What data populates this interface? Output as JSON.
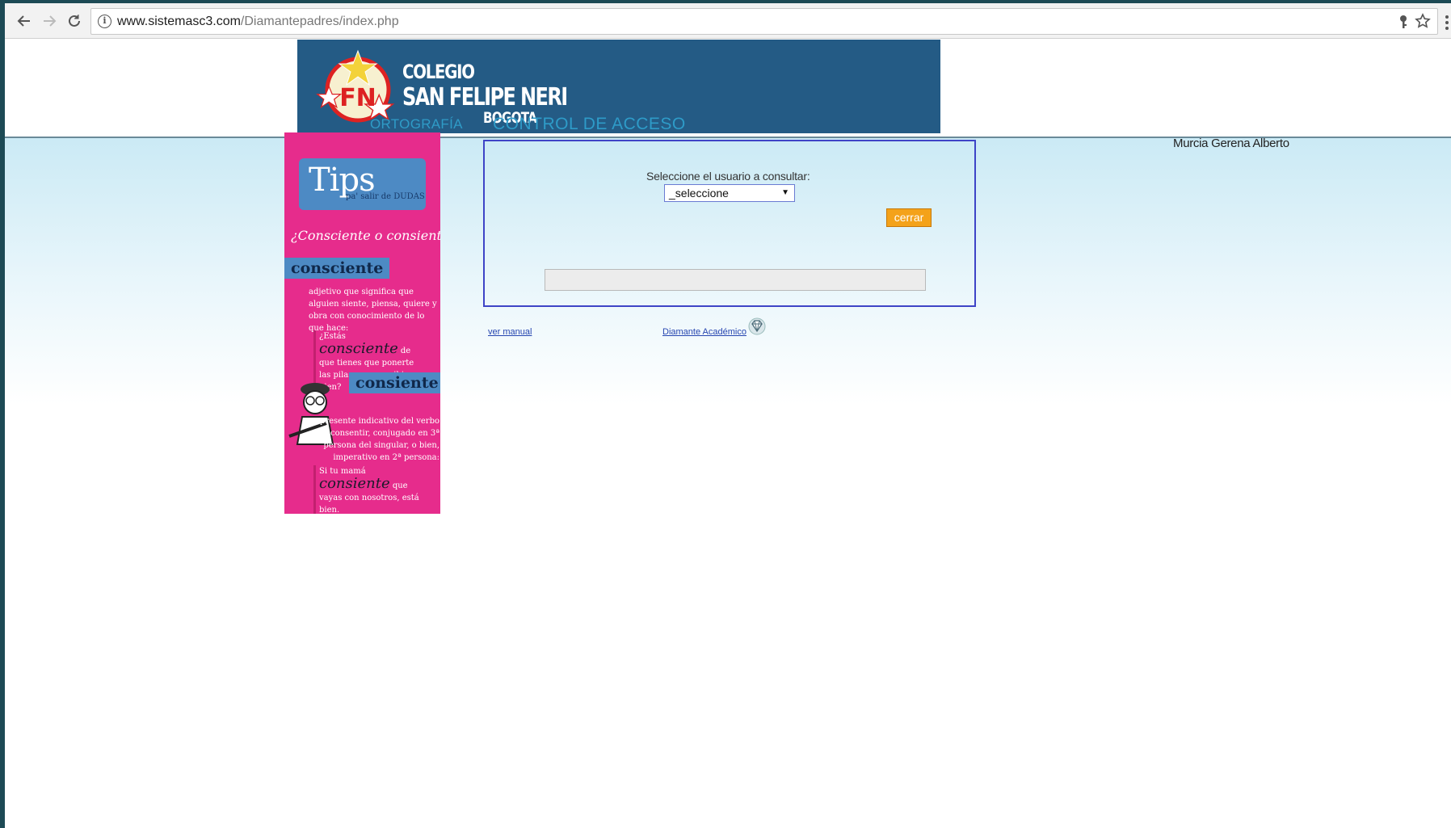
{
  "browser": {
    "url_domain": "www.sistemasc3.com",
    "url_path": "/Diamantepadres/index.php"
  },
  "banner": {
    "line1": "COLEGIO",
    "line2": "SAN FELIPE NERI",
    "line3": "BOGOTA",
    "logo_letters": "FN"
  },
  "header": {
    "user_name": "Murcia Gerena Alberto"
  },
  "sidebar": {
    "section_link": "ORTOGRAFÍA",
    "tips": {
      "title": "Tips",
      "subtitle": "pa' salir de DUDAS",
      "question": "¿Consciente o consiente?",
      "word1": "consciente",
      "def1": "adjetivo que significa que alguien siente, piensa, quiere y obra con conocimiento de lo que hace:",
      "ex1_pre": "¿Estás ",
      "ex1_word": "consciente",
      "ex1_post": " de que tienes que ponerte las pilas para escribir bien?",
      "word2": "consiente",
      "def2": "presente indicativo del verbo consentir, conjugado en 3ª persona del singular, o bien, imperativo en 2ª persona:",
      "ex2_pre": "Si tu mamá ",
      "ex2_word": "consiente",
      "ex2_post": " que vayas con nosotros, está bien."
    }
  },
  "main": {
    "title": "CONTROL DE ACCESO",
    "select_label": "Seleccione el usuario a consultar:",
    "select_value": "_seleccione",
    "close_button": "cerrar",
    "result_text": ""
  },
  "footer": {
    "manual_link": "ver manual",
    "diamante_link": "Diamante Académico"
  },
  "colors": {
    "banner_bg": "#245b85",
    "accent_title": "#2e9bc8",
    "button_orange": "#f4a21a",
    "tips_pink": "#e62c8c"
  }
}
